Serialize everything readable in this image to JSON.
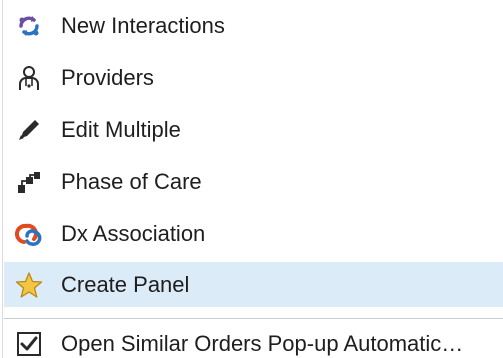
{
  "menu": {
    "items": [
      {
        "label": "New Interactions",
        "icon": "new-interactions-icon"
      },
      {
        "label": "Providers",
        "icon": "providers-icon"
      },
      {
        "label": "Edit Multiple",
        "icon": "pencil-icon"
      },
      {
        "label": "Phase of Care",
        "icon": "phase-of-care-icon"
      },
      {
        "label": "Dx Association",
        "icon": "dx-association-icon"
      },
      {
        "label": "Create Panel",
        "icon": "star-icon",
        "highlighted": true
      },
      {
        "label": "Open Similar Orders Pop-up Automatic…",
        "icon": "checkbox-checked-icon",
        "checked": true
      }
    ]
  },
  "colors": {
    "highlight": "#dcebf8",
    "accent_purple": "#6a4fa3",
    "accent_blue": "#2b73c2",
    "dx_red": "#e04a1f",
    "star_gold": "#f4c542"
  }
}
